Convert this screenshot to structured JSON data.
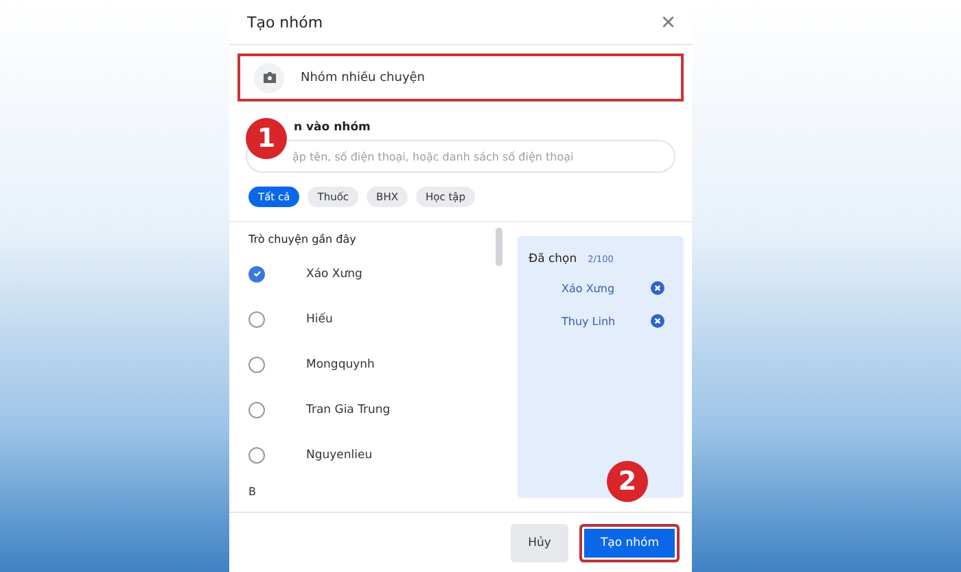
{
  "dialog": {
    "title": "Tạo nhóm",
    "close": "×"
  },
  "group_name": {
    "value": "Nhóm nhiều chuyện",
    "highlighted": true
  },
  "add_label": "n vào nhóm",
  "search": {
    "placeholder": "ập tên, số điện thoại, hoặc danh sách số điện thoại"
  },
  "filters": [
    {
      "label": "Tất cả",
      "selected": true
    },
    {
      "label": "Thuốc",
      "selected": false
    },
    {
      "label": "BHX",
      "selected": false
    },
    {
      "label": "Học tập",
      "selected": false
    }
  ],
  "recent_heading": "Trò chuyện gần đây",
  "contacts": [
    {
      "name": "Xáo Xưng",
      "checked": true
    },
    {
      "name": "Hiếu",
      "checked": false
    },
    {
      "name": "Mongquynh",
      "checked": false
    },
    {
      "name": "Tran Gia Trung",
      "checked": false
    },
    {
      "name": "Nguyenlieu",
      "checked": false
    }
  ],
  "section_letter": "B",
  "chosen": {
    "title": "Đã chọn",
    "count": "2/100",
    "items": [
      "Xáo Xưng",
      "Thuy Linh"
    ]
  },
  "buttons": [
    {
      "label": "Hủy",
      "kind": "secondary",
      "highlighted": false
    },
    {
      "label": "Tạo nhóm",
      "kind": "primary",
      "highlighted": true
    }
  ],
  "badges": [
    "1",
    "2"
  ]
}
